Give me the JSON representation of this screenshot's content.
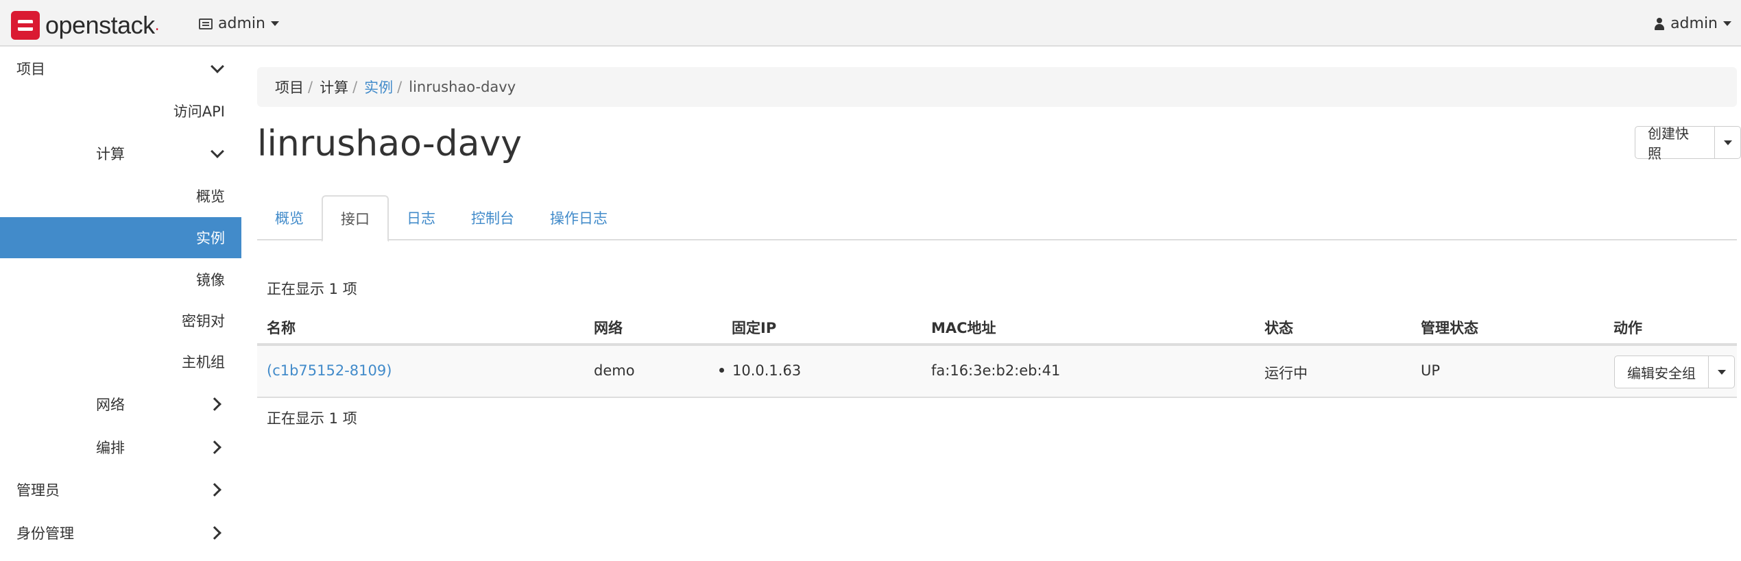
{
  "app": {
    "logo_text": "openstack",
    "project_label": "admin",
    "user_label": "admin"
  },
  "sidebar": {
    "items": [
      {
        "label": "项目"
      },
      {
        "label": "访问API"
      },
      {
        "label": "计算"
      },
      {
        "label": "概览"
      },
      {
        "label": "实例"
      },
      {
        "label": "镜像"
      },
      {
        "label": "密钥对"
      },
      {
        "label": "主机组"
      },
      {
        "label": "网络"
      },
      {
        "label": "编排"
      },
      {
        "label": "管理员"
      },
      {
        "label": "身份管理"
      }
    ]
  },
  "breadcrumb": {
    "items": [
      "项目",
      "计算",
      "实例",
      "linrushao-davy"
    ],
    "separator": "/"
  },
  "page": {
    "title": "linrushao-davy",
    "snapshot_button": "创建快照"
  },
  "tabs": [
    {
      "label": "概览"
    },
    {
      "label": "接口"
    },
    {
      "label": "日志"
    },
    {
      "label": "控制台"
    },
    {
      "label": "操作日志"
    }
  ],
  "table": {
    "count_top": "正在显示 1 项",
    "count_bottom": "正在显示 1 项",
    "headers": [
      "名称",
      "网络",
      "固定IP",
      "MAC地址",
      "状态",
      "管理状态",
      "动作"
    ],
    "rows": [
      {
        "name": "(c1b75152-8109)",
        "network": "demo",
        "fixed_ip": "10.0.1.63",
        "mac": "fa:16:3e:b2:eb:41",
        "status": "运行中",
        "admin_state": "UP",
        "action": "编辑安全组"
      }
    ]
  },
  "colors": {
    "accent": "#428bca",
    "brand": "#da1a32"
  }
}
